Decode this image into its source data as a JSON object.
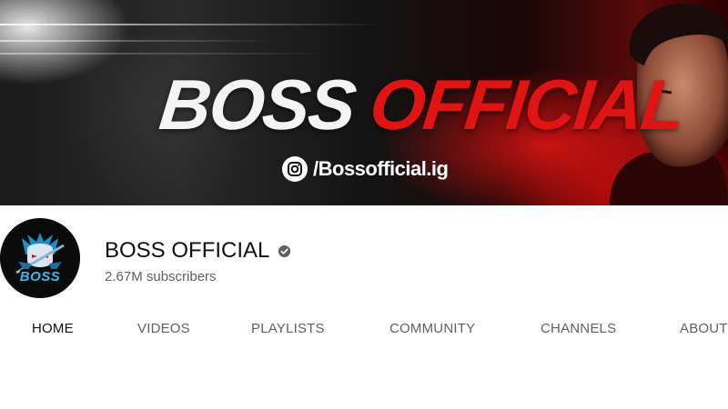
{
  "banner": {
    "title_part1": "BOSS",
    "title_part2": "OFFICIAL",
    "instagram_handle": "/Bossofficial.ig"
  },
  "channel": {
    "name": "BOSS OFFICIAL",
    "subscribers": "2.67M subscribers",
    "avatar_text": "BOSS",
    "verified_icon": "verified-check-icon"
  },
  "tabs": [
    {
      "label": "HOME",
      "active": true
    },
    {
      "label": "VIDEOS",
      "active": false
    },
    {
      "label": "PLAYLISTS",
      "active": false
    },
    {
      "label": "COMMUNITY",
      "active": false
    },
    {
      "label": "CHANNELS",
      "active": false
    },
    {
      "label": "ABOUT",
      "active": false
    }
  ],
  "colors": {
    "accent_red": "#e11414",
    "text_primary": "#0f0f0f",
    "text_secondary": "#606060"
  }
}
